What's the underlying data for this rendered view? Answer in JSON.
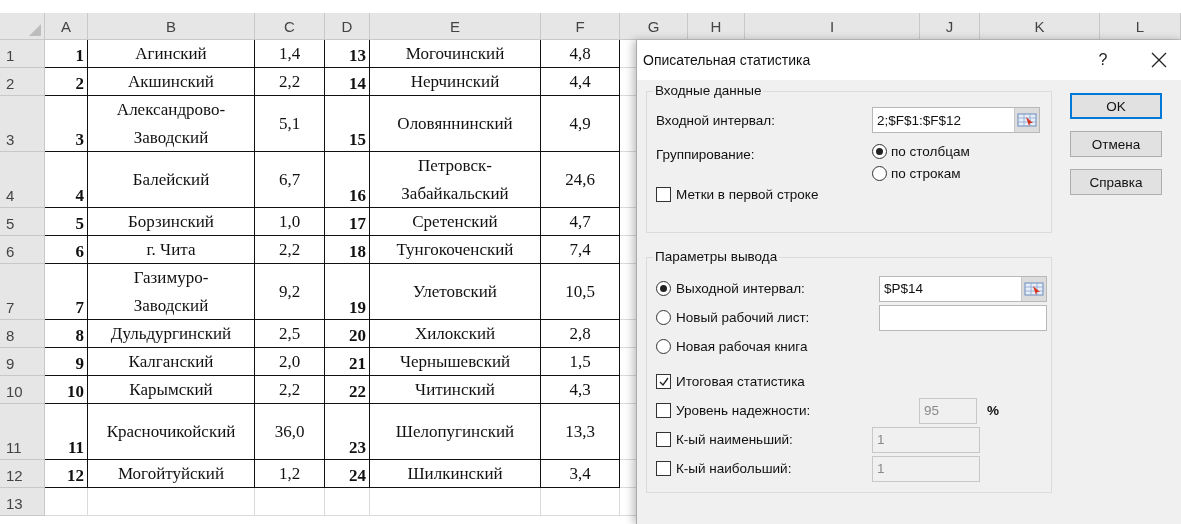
{
  "sheet": {
    "columns": [
      "A",
      "B",
      "C",
      "D",
      "E",
      "F",
      "G",
      "H",
      "I",
      "J",
      "K",
      "L"
    ],
    "rows": [
      {
        "number": "1",
        "tall": false,
        "cells": [
          "1",
          "Агинский",
          "1,4",
          "13",
          "Могочинский",
          "4,8"
        ]
      },
      {
        "number": "2",
        "tall": false,
        "cells": [
          "2",
          "Акшинский",
          "2,2",
          "14",
          "Нерчинский",
          "4,4"
        ]
      },
      {
        "number": "3",
        "tall": true,
        "cells": [
          "3",
          "Александрово-Заводский",
          "5,1",
          "15",
          "Оловяннинский",
          "4,9"
        ]
      },
      {
        "number": "4",
        "tall": true,
        "cells": [
          "4",
          "Балейский",
          "6,7",
          "16",
          "Петровск-Забайкальский",
          "24,6"
        ]
      },
      {
        "number": "5",
        "tall": false,
        "cells": [
          "5",
          "Борзинский",
          "1,0",
          "17",
          "Сретенский",
          "4,7"
        ]
      },
      {
        "number": "6",
        "tall": false,
        "cells": [
          "6",
          "г. Чита",
          "2,2",
          "18",
          "Тунгокоченский",
          "7,4"
        ]
      },
      {
        "number": "7",
        "tall": true,
        "cells": [
          "7",
          "Газимуро-Заводский",
          "9,2",
          "19",
          "Улетовский",
          "10,5"
        ]
      },
      {
        "number": "8",
        "tall": false,
        "cells": [
          "8",
          "Дульдургинский",
          "2,5",
          "20",
          "Хилокский",
          "2,8"
        ]
      },
      {
        "number": "9",
        "tall": false,
        "cells": [
          "9",
          "Калганский",
          "2,0",
          "21",
          "Чернышевский",
          "1,5"
        ]
      },
      {
        "number": "10",
        "tall": false,
        "cells": [
          "10",
          "Карымский",
          "2,2",
          "22",
          "Читинский",
          "4,3"
        ]
      },
      {
        "number": "11",
        "tall": true,
        "cells": [
          "11",
          "Красночикойский",
          "36,0",
          "23",
          "Шелопугинский",
          "13,3"
        ]
      },
      {
        "number": "12",
        "tall": false,
        "cells": [
          "12",
          "Могойтуйский",
          "1,2",
          "24",
          "Шилкинский",
          "3,4"
        ]
      },
      {
        "number": "13",
        "tall": false
      }
    ]
  },
  "dialog": {
    "title": "Описательная статистика",
    "help": "?",
    "input_group": {
      "legend": "Входные данные",
      "range_label": "Входной интервал:",
      "range_value": "2;$F$1:$F$12",
      "grouping_label": "Группирование:",
      "grouping_options": [
        {
          "label": "по столбцам",
          "selected": true
        },
        {
          "label": "по строкам",
          "selected": false
        }
      ],
      "labels_checkbox": {
        "label": "Метки в первой строке",
        "checked": false
      }
    },
    "output_group": {
      "legend": "Параметры вывода",
      "items": [
        {
          "kind": "radio",
          "label": "Выходной интервал:",
          "selected": true,
          "field": {
            "value": "$P$14",
            "picker": true,
            "disabled": false
          }
        },
        {
          "kind": "radio",
          "label": "Новый рабочий лист:",
          "selected": false,
          "field": {
            "picker": false,
            "disabled": false
          }
        },
        {
          "kind": "radio",
          "label": "Новая рабочая книга",
          "selected": false
        },
        {
          "kind": "checkbox",
          "label": "Итоговая статистика",
          "checked": true
        },
        {
          "kind": "checkbox",
          "label": "Уровень надежности:",
          "checked": false,
          "field": {
            "value": "95",
            "picker": false,
            "disabled": true,
            "suffix": "%"
          }
        },
        {
          "kind": "checkbox",
          "label": "К-ый наименьший:",
          "checked": false,
          "field": {
            "value": "1",
            "picker": false,
            "disabled": true
          }
        },
        {
          "kind": "checkbox",
          "label": "К-ый наибольший:",
          "checked": false,
          "field": {
            "value": "1",
            "picker": false,
            "disabled": true
          }
        }
      ]
    },
    "buttons": [
      {
        "label": "OK",
        "default": true
      },
      {
        "label": "Отмена",
        "default": false
      },
      {
        "label": "Справка",
        "default": false
      }
    ]
  }
}
